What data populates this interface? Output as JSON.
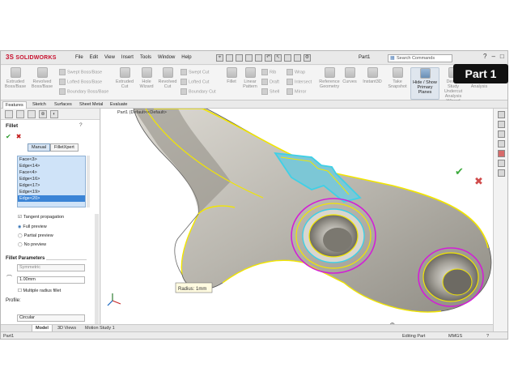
{
  "app": {
    "logo_prefix": "3S",
    "logo_name": "SOLIDWORKS",
    "menu": [
      "File",
      "Edit",
      "View",
      "Insert",
      "Tools",
      "Window",
      "Help"
    ],
    "document_name": "Part1",
    "search_placeholder": "Search Commands",
    "window_buttons": [
      "?",
      "–",
      "□",
      "×"
    ]
  },
  "overlay_badge": "Part 1",
  "ribbon": {
    "large_buttons": [
      {
        "label": "Extruded Boss/Base",
        "icon": "extrude-boss-icon"
      },
      {
        "label": "Revolved Boss/Base",
        "icon": "revolve-boss-icon"
      },
      {
        "label": "Extruded Cut",
        "icon": "extrude-cut-icon"
      },
      {
        "label": "Hole Wizard",
        "icon": "hole-wizard-icon"
      },
      {
        "label": "Revolved Cut",
        "icon": "revolve-cut-icon"
      },
      {
        "label": "Fillet",
        "icon": "fillet-icon"
      },
      {
        "label": "Linear Pattern",
        "icon": "linear-pattern-icon"
      },
      {
        "label": "Reference Geometry",
        "icon": "reference-geometry-icon"
      },
      {
        "label": "Curves",
        "icon": "curves-icon"
      },
      {
        "label": "Instant3D",
        "icon": "instant3d-icon"
      },
      {
        "label": "Take Snapshot",
        "icon": "snapshot-icon"
      },
      {
        "label": "Hide / Show Primary Planes",
        "icon": "planes-icon"
      },
      {
        "label": "Design Study",
        "icon": "design-study-icon"
      },
      {
        "label": "Geometry Analysis",
        "icon": "geometry-analysis-icon"
      }
    ],
    "small_buttons": [
      {
        "label": "Swept Boss/Base"
      },
      {
        "label": "Lofted Boss/Base"
      },
      {
        "label": "Boundary Boss/Base"
      },
      {
        "label": "Swept Cut"
      },
      {
        "label": "Lofted Cut"
      },
      {
        "label": "Boundary Cut"
      },
      {
        "label": "Rib"
      },
      {
        "label": "Draft"
      },
      {
        "label": "Shell"
      },
      {
        "label": "Wrap"
      },
      {
        "label": "Intersect"
      },
      {
        "label": "Mirror"
      }
    ],
    "extra_label_1": "Undercut Analysis",
    "extra_label_2": "Wizard"
  },
  "command_tabs": [
    "Features",
    "Sketch",
    "Surfaces",
    "Sheet Metal",
    "Evaluate"
  ],
  "fillet": {
    "title": "Fillet",
    "modes": [
      "Manual",
      "FilletXpert"
    ],
    "edges": [
      "Face<3>",
      "Edge<14>",
      "Face<4>",
      "Edge<16>",
      "Edge<17>",
      "Edge<19>",
      "Edge<20>"
    ],
    "selected_edge": "Edge<20>",
    "tangent_propagation": "Tangent propagation",
    "preview_options": [
      "Full preview",
      "Partial preview",
      "No preview"
    ],
    "params_header": "Fillet Parameters",
    "symmetric": "Symmetric",
    "radius_value": "1.00mm",
    "multiple_radius": "Multiple radius fillet",
    "profile_label": "Profile:",
    "profile_value": "Circular"
  },
  "viewport": {
    "breadcrumb": "Part1 (Default<<Default>",
    "callout": "Radius: 1mm"
  },
  "bottom_tabs": [
    "Model",
    "3D Views",
    "Motion Study 1"
  ],
  "status": {
    "left": "Part1",
    "mode": "Editing Part",
    "units": "MMGS"
  },
  "colors": {
    "highlight_yellow": "#f2e600",
    "highlight_cyan": "#3fd0e6",
    "highlight_magenta": "#d21fd6",
    "part_gray": "#b9b6ae",
    "selection_blue": "#3b84d6",
    "brand_red": "#c8102e"
  }
}
